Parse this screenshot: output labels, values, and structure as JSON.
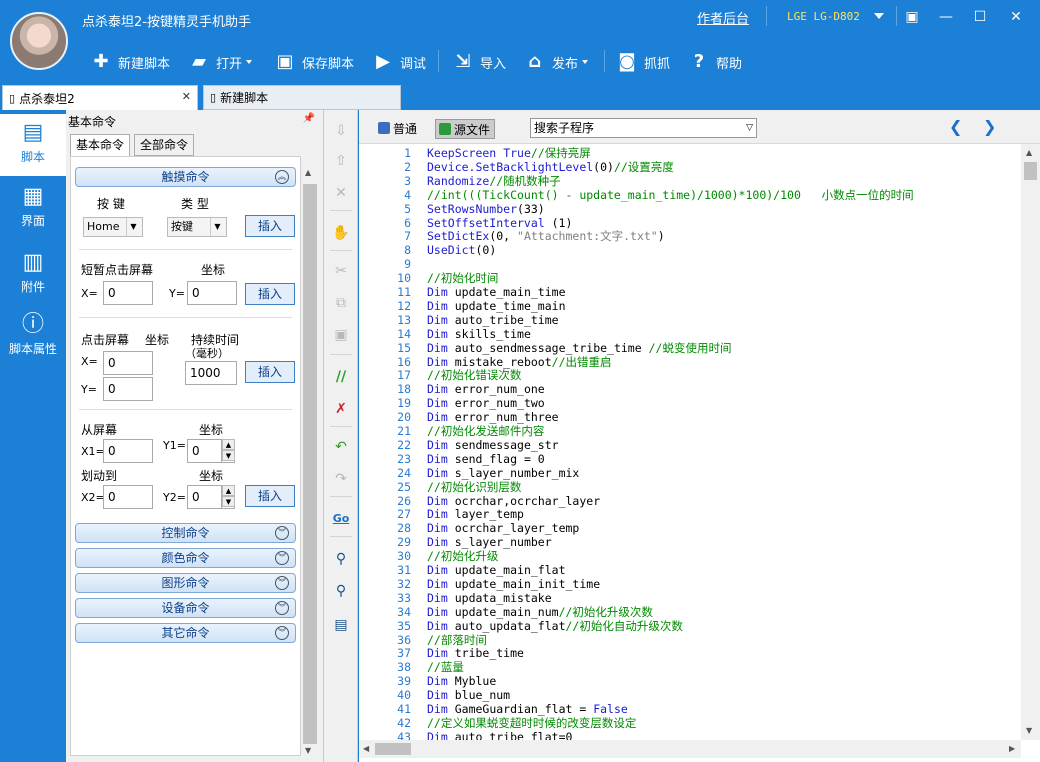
{
  "app": {
    "title": "点杀泰坦2-按键精灵手机助手",
    "author_link": "作者后台",
    "device": "LGE LG-D802"
  },
  "toolbar": {
    "new_script": "新建脚本",
    "open": "打开",
    "save_script": "保存脚本",
    "debug": "调试",
    "import": "导入",
    "publish": "发布",
    "capture": "抓抓",
    "help": "帮助"
  },
  "tabs": [
    {
      "label": "点杀泰坦2",
      "active": true
    },
    {
      "label": "新建脚本",
      "active": false
    }
  ],
  "leftnav": [
    {
      "label": "脚本",
      "icon": "script-icon",
      "active": true
    },
    {
      "label": "界面",
      "icon": "grid-icon",
      "active": false
    },
    {
      "label": "附件",
      "icon": "attachment-icon",
      "active": false
    },
    {
      "label": "脚本属性",
      "icon": "info-icon",
      "active": false
    }
  ],
  "cmdpanel": {
    "header": "基本命令",
    "subtabs": [
      "基本命令",
      "全部命令"
    ],
    "touch_section": "触摸命令",
    "key_label": "按 键",
    "type_label": "类 型",
    "key_value": "Home",
    "type_value": "按键",
    "insert": "插入",
    "tap_label": "短暂点击屏幕",
    "coord": "坐标",
    "x_eq": "X=",
    "y_eq": "Y=",
    "zero": "0",
    "press_label": "点击屏幕",
    "duration_label": "持续时间",
    "duration_unit": "（毫秒）",
    "duration_value": "1000",
    "from_screen": "从屏幕",
    "swipe_to": "划动到",
    "x1": "X1=",
    "y1": "Y1=",
    "x2": "X2=",
    "y2": "Y2=",
    "sections": [
      "控制命令",
      "颜色命令",
      "图形命令",
      "设备命令",
      "其它命令"
    ]
  },
  "editor": {
    "mode_normal": "普通",
    "mode_source": "源文件",
    "search_placeholder": "搜索子程序",
    "lines": [
      {
        "n": "1",
        "t": "KeepScreen True//保持亮屏"
      },
      {
        "n": "2",
        "t": "Device.SetBacklightLevel(0)//设置亮度"
      },
      {
        "n": "3",
        "t": "Randomize//随机数种子"
      },
      {
        "n": "4",
        "t": "//int(((TickCount() - update_main_time)/1000)*100)/100   小数点一位的时间"
      },
      {
        "n": "5",
        "t": "SetRowsNumber(33)"
      },
      {
        "n": "6",
        "t": "SetOffsetInterval (1)"
      },
      {
        "n": "7",
        "t": "SetDictEx(0, \"Attachment:文字.txt\")"
      },
      {
        "n": "8",
        "t": "UseDict(0)"
      },
      {
        "n": "9",
        "t": ""
      },
      {
        "n": "10",
        "t": "//初始化时间"
      },
      {
        "n": "11",
        "t": "Dim update_main_time"
      },
      {
        "n": "12",
        "t": "Dim update_time_main"
      },
      {
        "n": "13",
        "t": "Dim auto_tribe_time"
      },
      {
        "n": "14",
        "t": "Dim skills_time"
      },
      {
        "n": "15",
        "t": "Dim auto_sendmessage_tribe_time //蜕变使用时间"
      },
      {
        "n": "16",
        "t": "Dim mistake_reboot//出错重启"
      },
      {
        "n": "17",
        "t": "//初始化错误次数"
      },
      {
        "n": "18",
        "t": "Dim error_num_one"
      },
      {
        "n": "19",
        "t": "Dim error_num_two"
      },
      {
        "n": "20",
        "t": "Dim error_num_three"
      },
      {
        "n": "21",
        "t": "//初始化发送邮件内容"
      },
      {
        "n": "22",
        "t": "Dim sendmessage_str"
      },
      {
        "n": "23",
        "t": "Dim send_flag = 0"
      },
      {
        "n": "24",
        "t": "Dim s_layer_number_mix"
      },
      {
        "n": "25",
        "t": "//初始化识别层数"
      },
      {
        "n": "26",
        "t": "Dim ocrchar,ocrchar_layer"
      },
      {
        "n": "27",
        "t": "Dim layer_temp"
      },
      {
        "n": "28",
        "t": "Dim ocrchar_layer_temp"
      },
      {
        "n": "29",
        "t": "Dim s_layer_number"
      },
      {
        "n": "30",
        "t": "//初始化升级"
      },
      {
        "n": "31",
        "t": "Dim update_main_flat"
      },
      {
        "n": "32",
        "t": "Dim update_main_init_time"
      },
      {
        "n": "33",
        "t": "Dim updata_mistake"
      },
      {
        "n": "34",
        "t": "Dim update_main_num//初始化升级次数"
      },
      {
        "n": "35",
        "t": "Dim auto_updata_flat//初始化自动升级次数"
      },
      {
        "n": "36",
        "t": "//部落时间"
      },
      {
        "n": "37",
        "t": "Dim tribe_time"
      },
      {
        "n": "38",
        "t": "//蓝量"
      },
      {
        "n": "39",
        "t": "Dim Myblue"
      },
      {
        "n": "40",
        "t": "Dim blue_num"
      },
      {
        "n": "41",
        "t": "Dim GameGuardian_flat = False"
      },
      {
        "n": "42",
        "t": "//定义如果蜕变超时时候的改变层数设定"
      },
      {
        "n": "43",
        "t": "Dim auto_tribe_flat=0"
      }
    ]
  },
  "colors": {
    "brand": "#1b80d6",
    "keyword": "#1c1cd0",
    "comment": "#008a00",
    "line_number": "#2a7bd0"
  }
}
